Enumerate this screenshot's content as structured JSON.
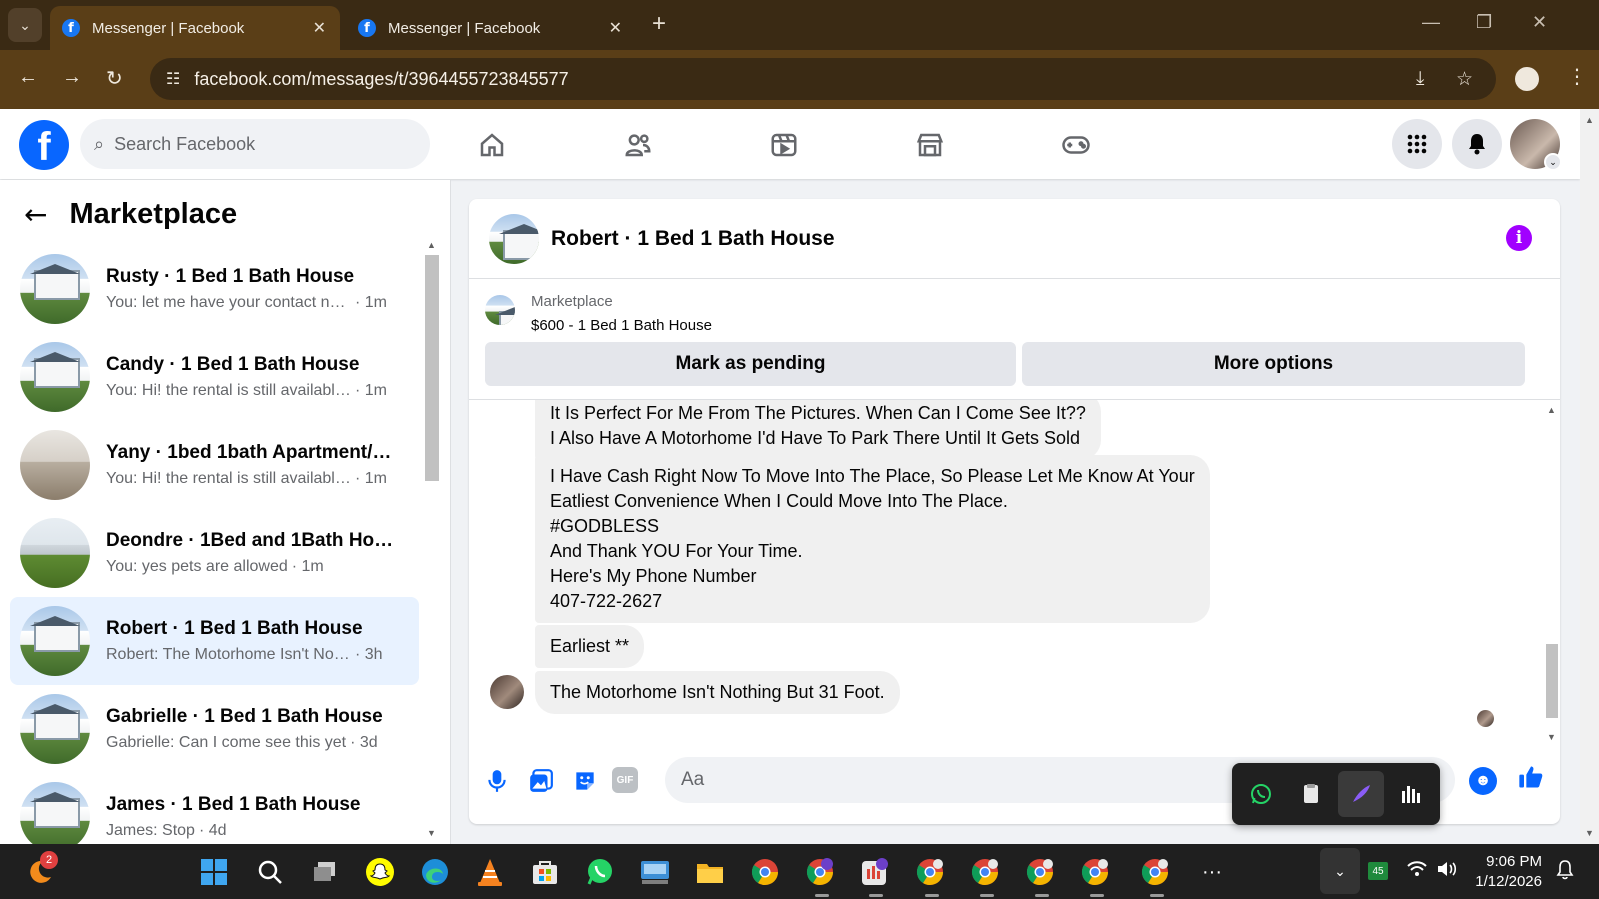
{
  "browser": {
    "tabs": [
      {
        "title": "Messenger | Facebook",
        "active": true
      },
      {
        "title": "Messenger | Facebook",
        "active": false
      }
    ],
    "url": "facebook.com/messages/t/3964455723845577"
  },
  "fb_header": {
    "search_placeholder": "Search Facebook",
    "nav_icons": [
      "home-icon",
      "friends-icon",
      "video-icon",
      "marketplace-icon",
      "gaming-icon"
    ],
    "right_icons": [
      "menu-grid-icon",
      "notifications-bell-icon",
      "profile-avatar"
    ]
  },
  "left_panel": {
    "title": "Marketplace",
    "conversations": [
      {
        "name": "Rusty · 1 Bed 1 Bath House",
        "preview": "You: let me have your contact nu...",
        "time": "· 1m",
        "thumb": "house",
        "selected": false
      },
      {
        "name": "Candy · 1 Bed 1 Bath House",
        "preview": "You: Hi! the rental is still available! ...",
        "time": "· 1m",
        "thumb": "house",
        "selected": false
      },
      {
        "name": "Yany · 1bed 1bath Apartment/co...",
        "preview": "You: Hi! the rental is still available! ...",
        "time": "· 1m",
        "thumb": "interior",
        "selected": false
      },
      {
        "name": "Deondre · 1Bed and 1Bath Hous...",
        "preview": "You: yes pets are allowed",
        "time": "· 1m",
        "thumb": "yard",
        "selected": false
      },
      {
        "name": "Robert · 1 Bed 1 Bath House",
        "preview": "Robert: The Motorhome Isn't Nothi...",
        "time": "· 3h",
        "thumb": "house",
        "selected": true
      },
      {
        "name": "Gabrielle · 1 Bed 1 Bath House",
        "preview": "Gabrielle: Can I come see this yet",
        "time": "· 3d",
        "thumb": "house",
        "selected": false
      },
      {
        "name": "James · 1 Bed 1 Bath House",
        "preview": "James: Stop",
        "time": "· 4d",
        "thumb": "house",
        "selected": false
      }
    ]
  },
  "chat": {
    "title": "Robert · 1 Bed 1 Bath House",
    "listing_source": "Marketplace",
    "listing_title": "$600 - 1 Bed 1 Bath House",
    "mark_pending_label": "Mark as pending",
    "more_options_label": "More options",
    "messages": [
      "It Is Perfect For Me From The Pictures. When Can I Come See It??\nI Also Have A Motorhome I'd Have To Park There Until It Gets Sold",
      "I Have Cash Right Now To Move Into The Place,  So Please Let Me Know At Your\nEatliest Convenience When I Could Move Into The Place.\n#GODBLESS\nAnd Thank YOU For Your Time.\nHere's My Phone Number\n407-722-2627",
      "Earliest **",
      "The Motorhome Isn't Nothing But 31 Foot."
    ],
    "input_placeholder": "Aa"
  },
  "taskbar": {
    "badge_count": "2",
    "tray_number": "45",
    "time": "9:06 PM",
    "date": "1/12/2026"
  }
}
